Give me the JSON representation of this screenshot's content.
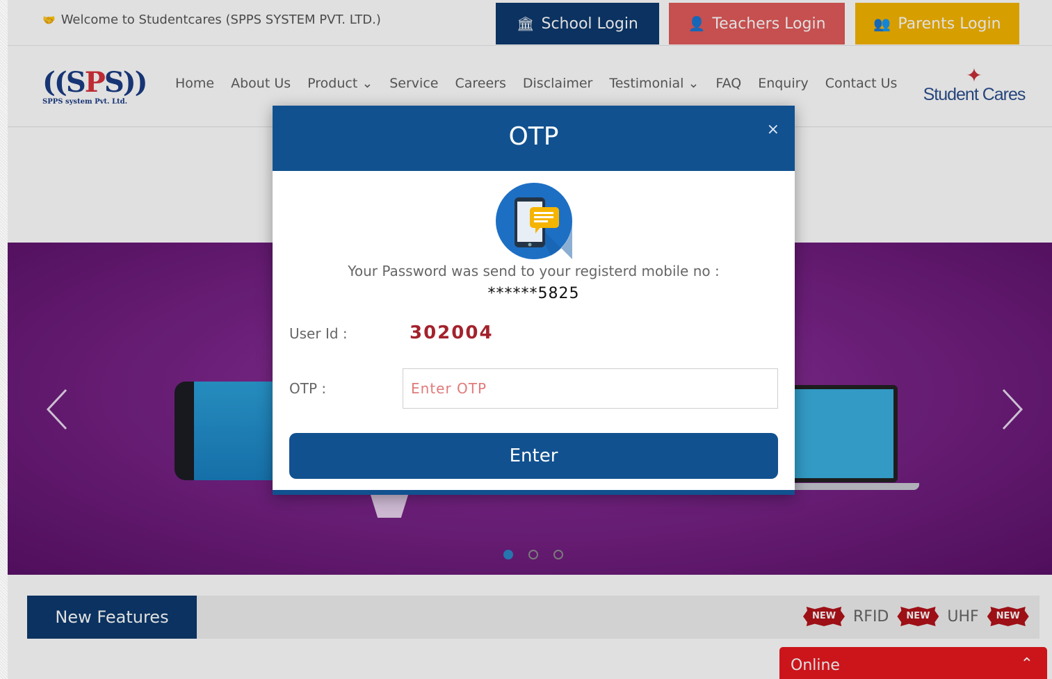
{
  "topbar": {
    "welcome": "Welcome to Studentcares (SPPS SYSTEM PVT. LTD.)",
    "school_login": "School Login",
    "teachers_login": "Teachers Login",
    "parents_login": "Parents Login"
  },
  "logo": {
    "mark_left": "((S",
    "mark_p": "P",
    "mark_right": "S))",
    "sub": "SPPS system Pvt. Ltd."
  },
  "nav": {
    "items": [
      "Home",
      "About Us",
      "Product ⌄",
      "Service",
      "Careers",
      "Disclaimer",
      "Testimonial ⌄",
      "FAQ",
      "Enquiry",
      "Contact Us"
    ]
  },
  "brand": {
    "name": "Student Cares"
  },
  "modal": {
    "title": "OTP",
    "close": "×",
    "message": "Your Password was send to your registerd mobile no :",
    "masked_mobile": "******5825",
    "user_id_label": "User Id :",
    "user_id": "302004",
    "otp_label": "OTP :",
    "otp_placeholder": "Enter OTP",
    "otp_value": "",
    "enter_label": "Enter"
  },
  "carousel": {
    "active_slide": 1,
    "slide_count": 3
  },
  "features": {
    "title": "New Features",
    "badge": "NEW",
    "items": [
      "RFID",
      "UHF"
    ]
  },
  "chat": {
    "label": "Online"
  },
  "colors": {
    "primary": "#11518f",
    "school": "#0d3a6e",
    "teachers": "#e25a5a",
    "parents": "#f5b400",
    "accent_red": "#a3222c",
    "chat": "#e7191f"
  },
  "icons": {
    "welcome": "handshake-icon",
    "school": "bank-icon",
    "teachers": "user-icon",
    "parents": "users-icon",
    "otp": "mobile-message-icon"
  }
}
